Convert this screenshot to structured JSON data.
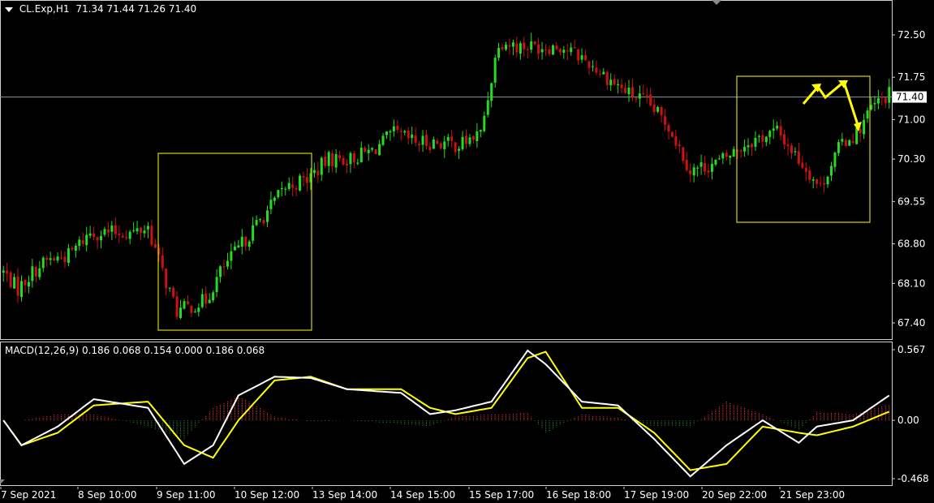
{
  "header": {
    "symbol": "CL.Exp,H1",
    "ohlc": "71.34 71.44 71.26 71.40"
  },
  "price_axis": {
    "ticks": [
      "72.50",
      "71.75",
      "71.00",
      "70.30",
      "69.55",
      "68.80",
      "68.10",
      "67.40"
    ],
    "tick_values": [
      72.5,
      71.75,
      71.0,
      70.3,
      69.55,
      68.8,
      68.1,
      67.4
    ],
    "current_price_label": "71.40",
    "current_price": 71.4
  },
  "macd": {
    "label": "MACD(12,26,9) 0.186 0.068 0.154 0.000 0.186 0.068",
    "axis_ticks": [
      "0.567",
      "0.00",
      "-0.468"
    ],
    "axis_values": [
      0.567,
      0.0,
      -0.468
    ]
  },
  "time_axis": {
    "labels": [
      "7 Sep 2021",
      "8 Sep 10:00",
      "9 Sep 11:00",
      "10 Sep 12:00",
      "13 Sep 14:00",
      "14 Sep 15:00",
      "15 Sep 17:00",
      "16 Sep 18:00",
      "17 Sep 19:00",
      "20 Sep 22:00",
      "21 Sep 23:00"
    ]
  },
  "colors": {
    "background": "#000000",
    "bull": "#22dd22",
    "bear": "#cc1111",
    "macd_line": "#ffffff",
    "signal_line": "#ffff00",
    "hist_pos": "#ff3b3b",
    "hist_neg": "#2e8b2e",
    "annotation": "#ffff00",
    "price_line": "#8899aa"
  },
  "chart_data": {
    "type": "candlestick",
    "price_path": {
      "bars": [
        0,
        4,
        8,
        12,
        18,
        24,
        30,
        36,
        40,
        44,
        48,
        52,
        56,
        60,
        66,
        72,
        78,
        84,
        90,
        96,
        102,
        108,
        114,
        120,
        126,
        132,
        137,
        142,
        148,
        154,
        160,
        166,
        172,
        178,
        184,
        190,
        198,
        206,
        214,
        220,
        226,
        228,
        232,
        236,
        240,
        245
      ],
      "close": [
        68.3,
        68.0,
        68.3,
        68.5,
        68.6,
        69.0,
        69.0,
        69.0,
        69.1,
        68.3,
        67.6,
        67.7,
        67.8,
        68.3,
        68.8,
        69.3,
        69.8,
        69.95,
        70.3,
        70.3,
        70.45,
        70.75,
        70.6,
        70.6,
        70.55,
        70.75,
        72.4,
        72.3,
        72.3,
        72.3,
        72.1,
        71.8,
        71.5,
        71.3,
        70.9,
        70.1,
        70.25,
        70.6,
        70.8,
        70.3,
        69.8,
        70.1,
        70.6,
        70.75,
        71.2,
        71.45
      ]
    },
    "macd_path": {
      "bars": [
        0,
        5,
        15,
        25,
        40,
        50,
        58,
        65,
        75,
        85,
        95,
        110,
        118,
        125,
        135,
        145,
        150,
        160,
        170,
        180,
        190,
        200,
        210,
        220,
        225,
        235,
        245
      ],
      "macd": [
        0.0,
        -0.2,
        -0.05,
        0.17,
        0.1,
        -0.35,
        -0.2,
        0.2,
        0.35,
        0.34,
        0.25,
        0.22,
        0.05,
        0.08,
        0.15,
        0.56,
        0.45,
        0.15,
        0.12,
        -0.15,
        -0.45,
        -0.2,
        0.0,
        -0.18,
        -0.05,
        0.0,
        0.2
      ],
      "signal": [
        0.0,
        -0.2,
        -0.1,
        0.12,
        0.15,
        -0.2,
        -0.3,
        0.0,
        0.32,
        0.35,
        0.25,
        0.25,
        0.1,
        0.05,
        0.1,
        0.5,
        0.55,
        0.1,
        0.1,
        -0.1,
        -0.4,
        -0.35,
        -0.05,
        -0.1,
        -0.12,
        -0.05,
        0.07
      ]
    },
    "bar_count": 246
  }
}
